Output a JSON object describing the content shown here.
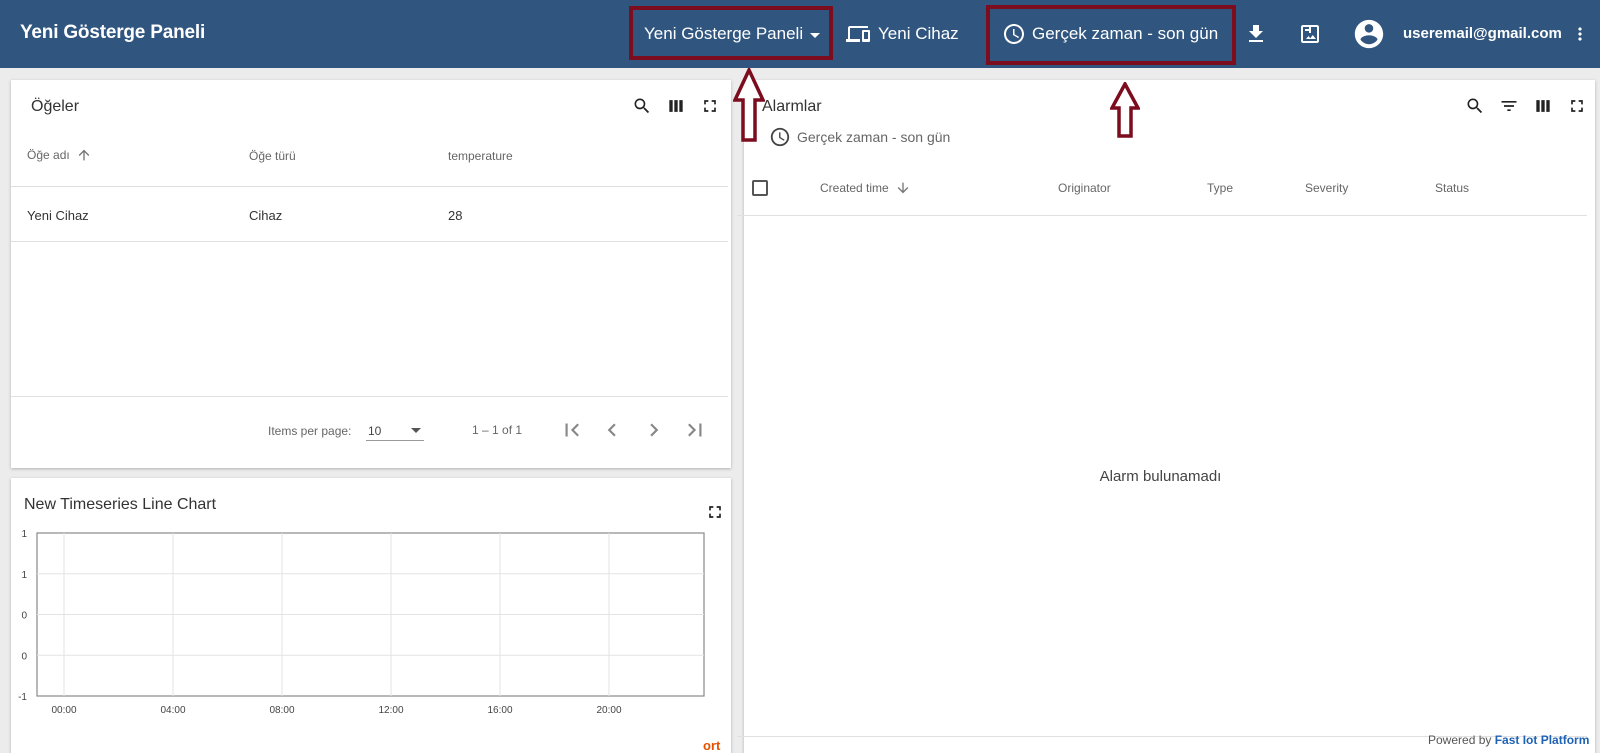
{
  "header": {
    "app_title": "Yeni Gösterge Paneli",
    "dashboard_select": "Yeni Gösterge Paneli",
    "entity_button": "Yeni Cihaz",
    "timewindow": "Gerçek zaman - son gün",
    "user_email": "useremail@gmail.com",
    "bg_color": "#305680",
    "highlight_color": "#7b0d1e"
  },
  "entities_panel": {
    "title": "Öğeler",
    "columns": [
      "Öğe adı",
      "Öğe türü",
      "temperature"
    ],
    "rows": [
      [
        "Yeni Cihaz",
        "Cihaz",
        "28"
      ]
    ],
    "items_per_page_label": "Items per page:",
    "items_per_page_value": "10",
    "range_label": "1 – 1 of 1"
  },
  "chart_panel": {
    "title": "New Timeseries Line Chart",
    "y_ticks": [
      "1",
      "1",
      "0",
      "0",
      "-1"
    ],
    "x_ticks": [
      "00:00",
      "04:00",
      "08:00",
      "12:00",
      "16:00",
      "20:00"
    ],
    "legend_fragment": "ort"
  },
  "chart_data": {
    "type": "line",
    "title": "New Timeseries Line Chart",
    "x": [
      "00:00",
      "04:00",
      "08:00",
      "12:00",
      "16:00",
      "20:00"
    ],
    "y_tick_labels": [
      "1",
      "1",
      "0",
      "0",
      "-1"
    ],
    "ylim": [
      -1,
      1
    ],
    "grid": true,
    "series": []
  },
  "alarms_panel": {
    "title": "Alarmlar",
    "timewindow": "Gerçek zaman - son gün",
    "columns": [
      "Created time",
      "Originator",
      "Type",
      "Severity",
      "Status"
    ],
    "empty_message": "Alarm bulunamadı"
  },
  "footer": {
    "powered_by": "Powered by",
    "platform": "Fast Iot Platform"
  }
}
